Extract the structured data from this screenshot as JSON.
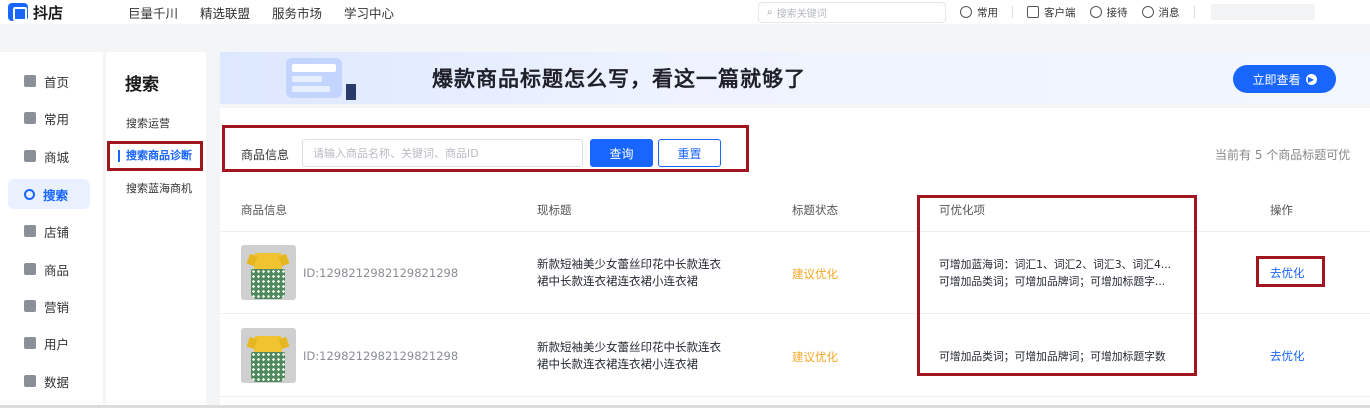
{
  "header": {
    "logo_text": "抖店",
    "nav": [
      "巨量千川",
      "精选联盟",
      "服务市场",
      "学习中心"
    ],
    "search_placeholder": "搜索关键词",
    "tools": [
      {
        "label": "常用",
        "icon": "clock-icon"
      },
      {
        "label": "客户端",
        "icon": "download-icon"
      },
      {
        "label": "接待",
        "icon": "headset-icon"
      },
      {
        "label": "消息",
        "icon": "bell-icon"
      }
    ]
  },
  "sidebar": {
    "items": [
      {
        "label": "首页",
        "icon": "home-icon"
      },
      {
        "label": "常用",
        "icon": "star-icon"
      },
      {
        "label": "商城",
        "icon": "store-icon"
      },
      {
        "label": "搜索",
        "icon": "search-icon",
        "active": true
      },
      {
        "label": "店铺",
        "icon": "shop-icon"
      },
      {
        "label": "商品",
        "icon": "product-icon"
      },
      {
        "label": "营销",
        "icon": "megaphone-icon"
      },
      {
        "label": "用户",
        "icon": "user-icon"
      },
      {
        "label": "数据",
        "icon": "pie-chart-icon"
      }
    ]
  },
  "subnav": {
    "title": "搜索",
    "items": [
      {
        "label": "搜索运营"
      },
      {
        "label": "搜索商品诊断",
        "active": true
      },
      {
        "label": "搜索蓝海商机"
      }
    ]
  },
  "banner": {
    "title": "爆款商品标题怎么写，看这一篇就够了",
    "button_label": "立即查看"
  },
  "filter": {
    "label": "商品信息",
    "placeholder": "请输入商品名称、关键词、商品ID",
    "query_label": "查询",
    "reset_label": "重置",
    "count_text": "当前有 5 个商品标题可优"
  },
  "table": {
    "columns": [
      "商品信息",
      "现标题",
      "标题状态",
      "可优化项",
      "操作"
    ],
    "rows": [
      {
        "id": "ID:1298212982129821298",
        "title": "新款短袖美少女蕾丝印花中长款连衣裙中长款连衣裙连衣裙小连衣裙",
        "status": "建议优化",
        "optimizations": [
          "可增加蓝海词：词汇1、词汇2、词汇3、词汇4...",
          "可增加品类词；可增加品牌词；可增加标题字..."
        ],
        "action": "去优化"
      },
      {
        "id": "ID:1298212982129821298",
        "title": "新款短袖美少女蕾丝印花中长款连衣裙中长款连衣裙连衣裙小连衣裙",
        "status": "建议优化",
        "optimizations": [
          "可增加品类词；可增加品牌词；可增加标题字数"
        ],
        "action": "去优化"
      }
    ]
  },
  "colors": {
    "accent": "#1966ff",
    "warning": "#f5a623",
    "highlight_box": "#a3161f"
  }
}
